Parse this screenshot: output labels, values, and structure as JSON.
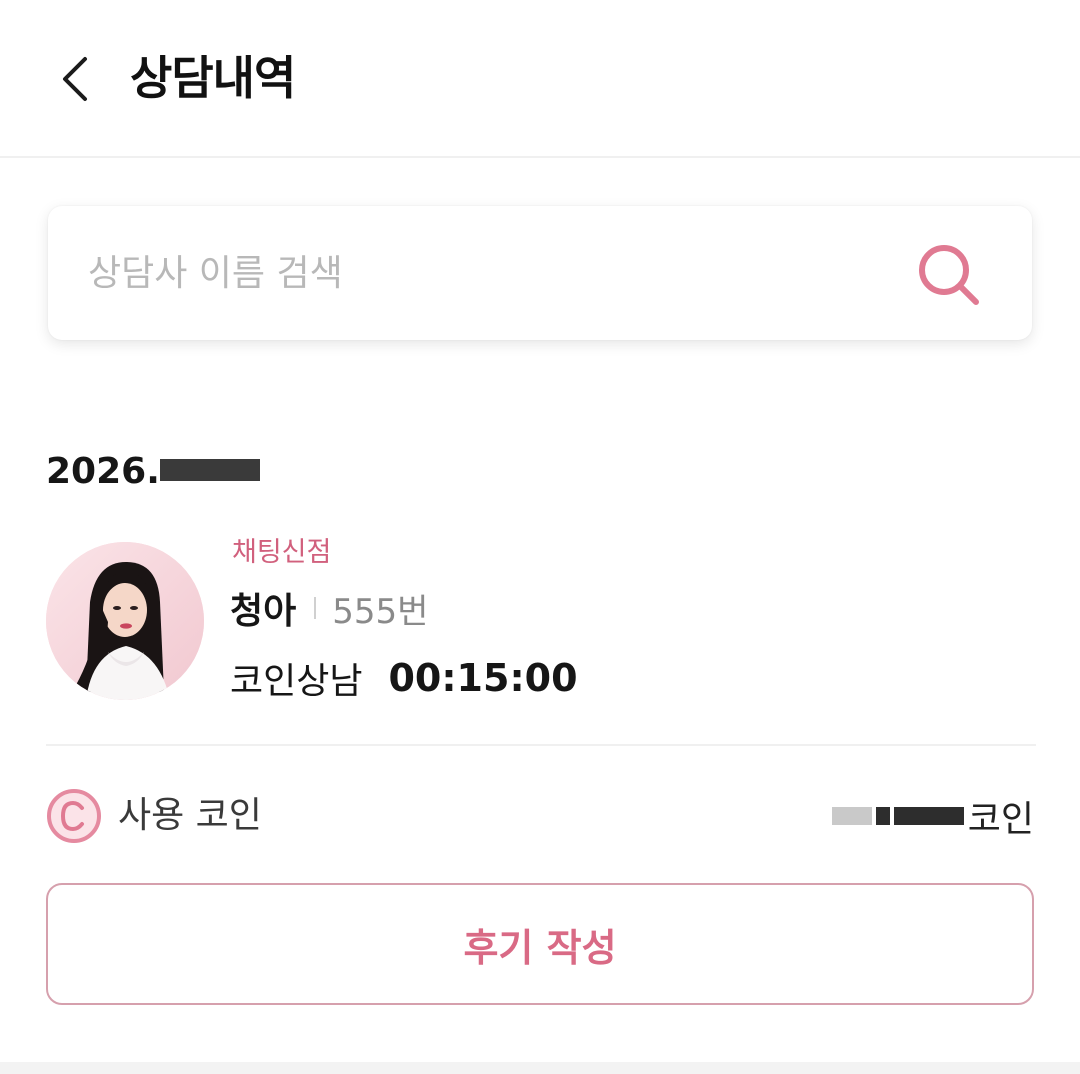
{
  "header": {
    "title": "상담내역",
    "back_icon": "chevron-left-icon"
  },
  "search": {
    "placeholder": "상담사 이름 검색",
    "value": "",
    "icon": "search-icon",
    "accent_color": "#e07a92"
  },
  "history": [
    {
      "date": "2026.",
      "branch": "채팅신점",
      "counselor_name": "청아",
      "counselor_number": "555번",
      "consult_type": "코인상남",
      "duration": "00:15:00",
      "coins_label": "사용 코인",
      "coins_unit": "코인",
      "coin_icon": "coin-icon",
      "review_button": "후기 작성"
    }
  ],
  "colors": {
    "accent": "#d96a85",
    "branch": "#d1607d",
    "border_pink": "#d6a0ad"
  }
}
